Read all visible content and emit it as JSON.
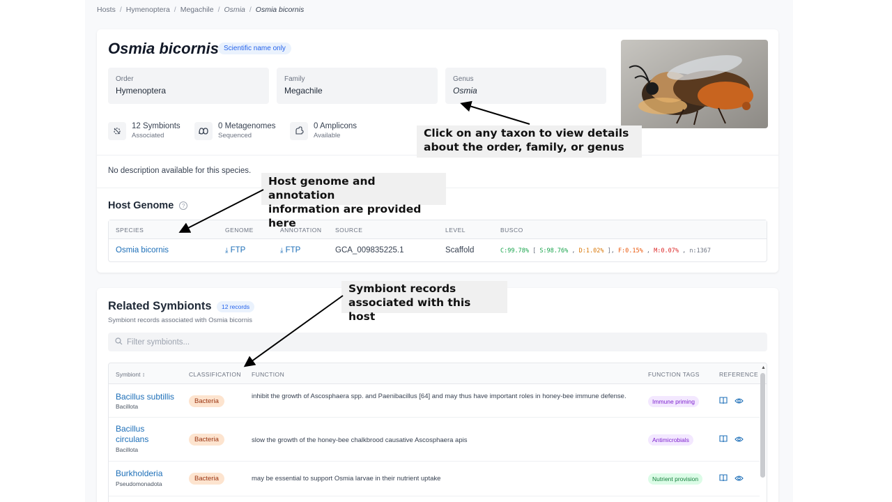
{
  "breadcrumb": {
    "items": [
      "Hosts",
      "Hymenoptera",
      "Megachile",
      "Osmia",
      "Osmia bicornis"
    ]
  },
  "host": {
    "title": "Osmia bicornis",
    "badge": "Scientific name only",
    "taxa": [
      {
        "label": "Order",
        "value": "Hymenoptera"
      },
      {
        "label": "Family",
        "value": "Megachile"
      },
      {
        "label": "Genus",
        "value": "Osmia"
      }
    ],
    "stats": [
      {
        "icon": "symbiont-icon",
        "count": "12 Symbionts",
        "sub": "Associated"
      },
      {
        "icon": "metagenome-icon",
        "count": "0 Metagenomes",
        "sub": "Sequenced"
      },
      {
        "icon": "amplicon-icon",
        "count": "0 Amplicons",
        "sub": "Available"
      }
    ],
    "description": "No description available for this species."
  },
  "host_genome": {
    "heading": "Host Genome",
    "columns": [
      "SPECIES",
      "GENOME",
      "ANNOTATION",
      "SOURCE",
      "LEVEL",
      "BUSCO"
    ],
    "row": {
      "species": "Osmia bicornis",
      "genome": "FTP",
      "annotation": "FTP",
      "source": "GCA_009835225.1",
      "level": "Scaffold",
      "busco": {
        "c": "C:99.78%",
        "s": "S:98.76%",
        "d": "D:1.02%",
        "f": "F:0.15%",
        "m": "M:0.07%",
        "n": "n:1367"
      }
    }
  },
  "symbionts": {
    "heading": "Related Symbionts",
    "badge": "12 records",
    "subtitle": "Symbiont records associated with Osmia bicornis",
    "filter_placeholder": "Filter symbionts...",
    "columns": {
      "symbiont": "Symbiont",
      "classification": "CLASSIFICATION",
      "function": "FUNCTION",
      "tags": "FUNCTION TAGS",
      "reference": "REFERENCE"
    },
    "rows": [
      {
        "name": "Bacillus subtillis",
        "phylum": "Bacillota",
        "classification": "Bacteria",
        "function": "inhibit the growth of Ascosphaera spp. and Paenibacillus [64] and may thus have important roles in honey-bee immune defense.",
        "tag": "Immune priming"
      },
      {
        "name": "Bacillus circulans",
        "phylum": "Bacillota",
        "classification": "Bacteria",
        "function": "slow the growth of the honey-bee chalkbrood causative Ascosphaera apis",
        "tag": "Antimicrobials"
      },
      {
        "name": "Burkholderia",
        "phylum": "Pseudomonadota",
        "classification": "Bacteria",
        "function": "may be essential to support Osmia larvae in their nutrient uptake",
        "tag": "Nutrient provision"
      }
    ]
  },
  "annotations": {
    "taxon": "Click on any taxon to view details\nabout the order, family, or genus",
    "genome": "Host genome and annotation\ninformation are provided here",
    "symbiont": "Symbiont records\nassociated with this host"
  }
}
